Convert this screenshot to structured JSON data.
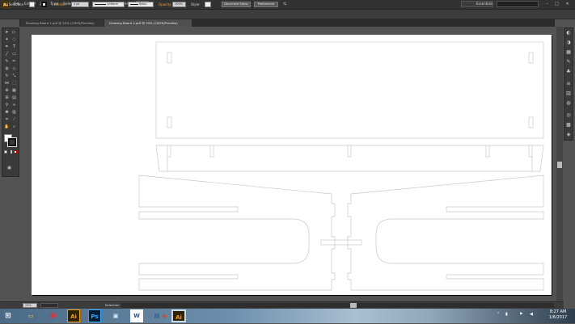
{
  "app": {
    "logo": "Ai"
  },
  "menu": [
    "File",
    "Edit",
    "Object",
    "Type",
    "Select",
    "Effect",
    "View",
    "Window",
    "Help"
  ],
  "window": {
    "workspace": "Essentials",
    "minimize": "–",
    "maximize": "□",
    "close": "✕"
  },
  "control": {
    "selection": "No Selection",
    "stroke_label": "Stroke:",
    "stroke_weight": "1 pt",
    "brush": "Uniform",
    "profile": "Basic",
    "opacity_label": "Opacity:",
    "opacity": "100%",
    "style_label": "Style:",
    "doc_setup": "Document Setup",
    "preferences": "Preferences"
  },
  "tabs": [
    {
      "label": "Drawing Board 1.pdf @ 25% (CMYK/Preview)",
      "active": false
    },
    {
      "label": "Drawing Board 2.pdf @ 25% (CMYK/Preview)",
      "active": true
    }
  ],
  "status": {
    "zoom": "25%",
    "tool": "Selection"
  },
  "taskbar": {
    "apps": [
      {
        "name": "start-button",
        "glyph": "⊞"
      },
      {
        "name": "file-explorer",
        "glyph": "▭"
      },
      {
        "name": "chrome",
        "glyph": "◉"
      },
      {
        "name": "illustrator",
        "glyph": "Ai"
      },
      {
        "name": "photoshop",
        "glyph": "Ps"
      },
      {
        "name": "media",
        "glyph": "▣"
      },
      {
        "name": "word",
        "glyph": "W"
      },
      {
        "name": "app-blue",
        "glyph": "▤"
      },
      {
        "name": "app-color",
        "glyph": "◆"
      },
      {
        "name": "illustrator-active",
        "glyph": "Ai"
      }
    ],
    "time": "8:27 AM",
    "date": "1/6/2017"
  },
  "colors": {
    "accent": "#ff9a00",
    "artboard": "#ffffff",
    "pasteboard": "#535353",
    "outline": "#c8c8c8"
  }
}
